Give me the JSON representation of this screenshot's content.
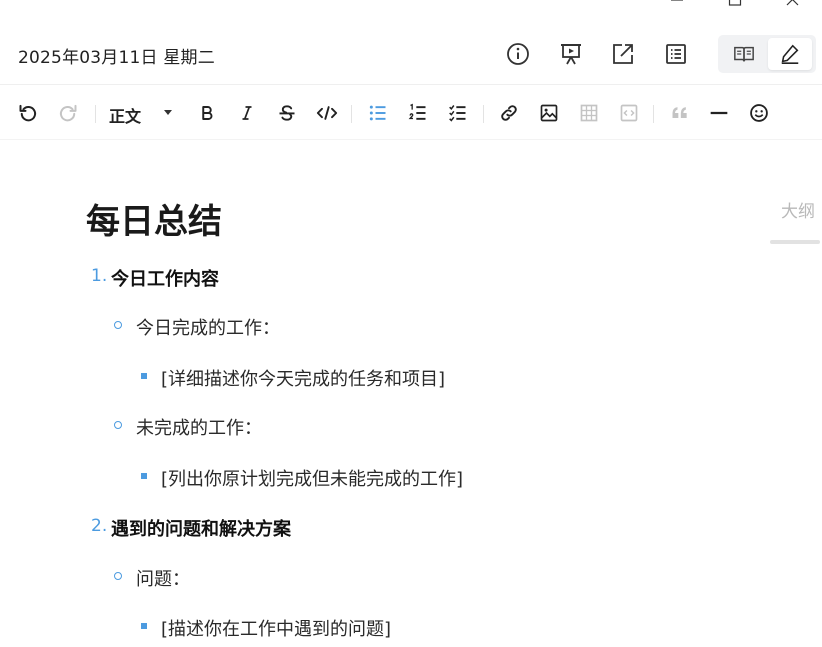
{
  "window": {
    "controls": [
      "minimize-icon",
      "maximize-icon",
      "close-icon"
    ]
  },
  "header": {
    "date": "2025年03月11日 星期二",
    "icons": [
      "info-icon",
      "presentation-icon",
      "export-icon",
      "list-icon"
    ],
    "mode_switch": {
      "options": [
        "read-mode-icon",
        "edit-mode-icon"
      ],
      "active": "edit"
    }
  },
  "toolbar": {
    "paragraph_style": "正文",
    "buttons": [
      "undo",
      "redo",
      "paragraph-style",
      "bold",
      "italic",
      "strikethrough",
      "code",
      "bullet-list",
      "ordered-list",
      "task-list",
      "link",
      "image",
      "table",
      "code-block",
      "quote",
      "horizontal-rule",
      "emoji"
    ],
    "active_button": "bullet-list"
  },
  "outline": {
    "label": "大纲"
  },
  "document": {
    "title": "每日总结",
    "sections": [
      {
        "number": "1.",
        "heading": "今日工作内容",
        "items": [
          {
            "text": "今日完成的工作：",
            "children": [
              "[详细描述你今天完成的任务和项目]"
            ]
          },
          {
            "text": "未完成的工作：",
            "children": [
              "[列出你原计划完成但未能完成的工作]"
            ]
          }
        ]
      },
      {
        "number": "2.",
        "heading": "遇到的问题和解决方案",
        "items": [
          {
            "text": "问题：",
            "children": [
              "[描述你在工作中遇到的问题]"
            ]
          }
        ]
      }
    ]
  },
  "colors": {
    "accent": "#4c9be0",
    "text": "#1f1f1f",
    "muted": "#b9b9b9",
    "disabled": "#c4c4c4"
  }
}
